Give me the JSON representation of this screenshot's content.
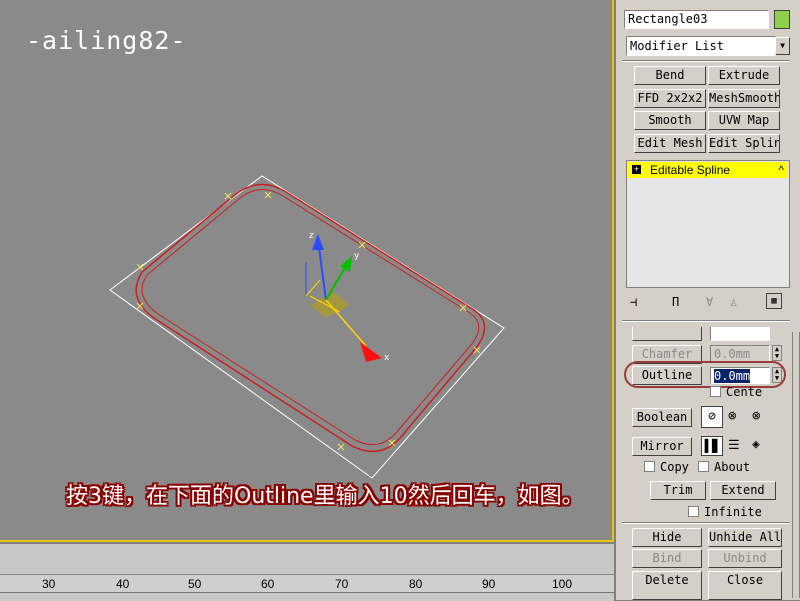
{
  "watermark": "-ailing82-",
  "caption": "按3键，在下面的Outline里输入10然后回车，如图。",
  "viewport": {
    "gizmo_labels": {
      "x": "x",
      "y": "y",
      "z": "z"
    }
  },
  "ruler": {
    "ticks": [
      "30",
      "40",
      "50",
      "60",
      "70",
      "80",
      "90",
      "100"
    ]
  },
  "panel": {
    "object_name": "Rectangle03",
    "object_color": "#8fd14a",
    "modifier_list": "Modifier List",
    "modifier_buttons": [
      "Bend",
      "Extrude",
      "FFD 2x2x2",
      "MeshSmooth",
      "Smooth",
      "UVW Map",
      "Edit Mesh",
      "Edit Spline"
    ],
    "stack_item": "Editable Spline",
    "chamfer_label": "Chamfer",
    "chamfer_value": "0.0mm",
    "outline_label": "Outline",
    "outline_value": "0.0mm",
    "center_label": "Cente",
    "boolean_label": "Boolean",
    "mirror_label": "Mirror",
    "copy_label": "Copy",
    "about_label": "About",
    "trim_label": "Trim",
    "extend_label": "Extend",
    "infinite_label": "Infinite",
    "hide_label": "Hide",
    "unhide_all_label": "Unhide All",
    "bind_label": "Bind",
    "unbind_label": "Unbind",
    "delete_label": "Delete",
    "close_label": "Close"
  }
}
